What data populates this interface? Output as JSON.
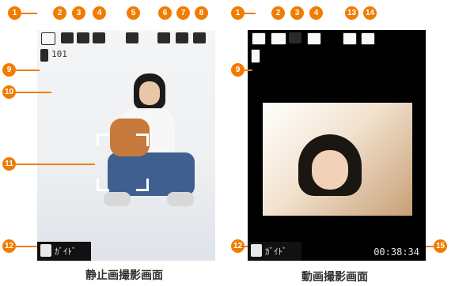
{
  "still_screen": {
    "caption": "静止画撮影画面",
    "status_icons": [
      "camera-icon",
      "image-size-icon",
      "quality-icon",
      "auto-icon",
      "hand-shake-icon",
      "self-timer-icon",
      "mute-icon",
      "ev-icon"
    ],
    "storage_icon": "phone-memory-icon",
    "shots_remaining": "101",
    "guide_label": "ｶﾞｲﾄﾞ"
  },
  "video_screen": {
    "caption": "動画撮影画面",
    "status_icons": [
      "video-mode-icon",
      "video-size-icon",
      "quality-icon",
      "auto-icon",
      "mic-icon",
      "recording-mode-icon"
    ],
    "storage_icon": "phone-memory-icon",
    "guide_label": "ｶﾞｲﾄﾞ",
    "remaining_time": "00:38:34"
  },
  "callouts": {
    "b1": "1",
    "b2": "2",
    "b3": "3",
    "b4": "4",
    "b5": "5",
    "b6": "6",
    "b7": "7",
    "b8": "8",
    "b9": "9",
    "b10": "10",
    "b11": "11",
    "b12": "12",
    "b13": "13",
    "b14": "14",
    "b15": "15"
  },
  "colors": {
    "accent": "#f07c00",
    "guide_bg": "#111111",
    "video_bg": "#000000"
  }
}
